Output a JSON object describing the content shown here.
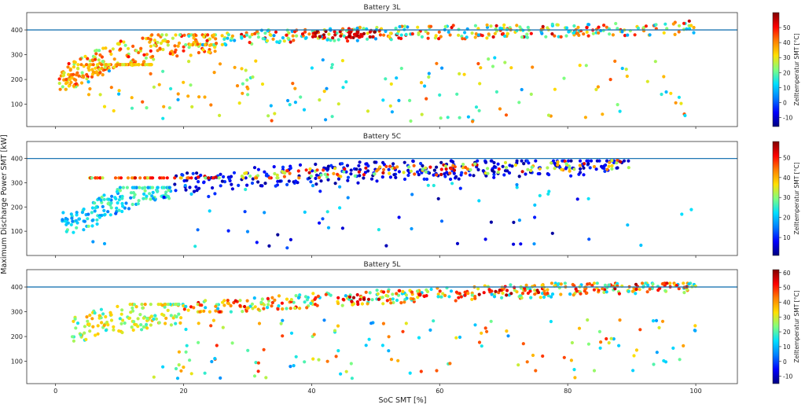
{
  "figure": {
    "ylabel": "Maximum Discharge Power SMT [kW]",
    "xlabel": "SoC SMT [%]",
    "colorbar_label": "Zelltemperatur SMT [°C]",
    "colormap": [
      "#00007f",
      "#0000ff",
      "#007fff",
      "#00e0ff",
      "#7fff7f",
      "#ffe000",
      "#ff7f00",
      "#ff0000",
      "#7f0000"
    ]
  },
  "chart_data": [
    {
      "type": "scatter",
      "title": "Battery 3L",
      "xlim": [
        -4.5,
        106.5
      ],
      "ylim": [
        10,
        470
      ],
      "yticks": [
        100,
        200,
        300,
        400
      ],
      "reference_line": 400,
      "color_range": [
        -16,
        60
      ],
      "colorbar_ticks": [
        -10,
        0,
        10,
        20,
        30,
        40,
        50
      ],
      "trend": [
        [
          0.5,
          190
        ],
        [
          2,
          210
        ],
        [
          5,
          250
        ],
        [
          8,
          280
        ],
        [
          10,
          300
        ],
        [
          15,
          330
        ],
        [
          20,
          350
        ],
        [
          30,
          370
        ],
        [
          40,
          380
        ],
        [
          50,
          385
        ],
        [
          60,
          390
        ],
        [
          70,
          395
        ],
        [
          80,
          400
        ],
        [
          90,
          405
        ],
        [
          100,
          410
        ]
      ],
      "clusters": [
        {
          "x0": 0.5,
          "x1": 25,
          "ylo": 160,
          "yhi": 380,
          "tlo": 20,
          "thi": 50,
          "n": 200
        },
        {
          "x0": 1,
          "x1": 15,
          "ylo": 70,
          "yhi": 260,
          "tlo": 25,
          "thi": 45,
          "n": 90
        },
        {
          "x0": 20,
          "x1": 100,
          "ylo": 340,
          "yhi": 450,
          "tlo": 5,
          "thi": 55,
          "n": 350
        },
        {
          "x0": 40,
          "x1": 50,
          "ylo": 340,
          "yhi": 405,
          "tlo": 50,
          "thi": 60,
          "n": 40
        },
        {
          "x0": 5,
          "x1": 100,
          "ylo": 30,
          "yhi": 300,
          "tlo": 5,
          "thi": 45,
          "n": 150
        }
      ]
    },
    {
      "type": "scatter",
      "title": "Battery 5C",
      "xlim": [
        -4.5,
        106.5
      ],
      "ylim": [
        0,
        470
      ],
      "yticks": [
        100,
        200,
        300,
        400
      ],
      "reference_line": 400,
      "color_range": [
        1,
        58
      ],
      "colorbar_ticks": [
        10,
        20,
        30,
        40,
        50
      ],
      "trend": [
        [
          0.5,
          160
        ],
        [
          2,
          120
        ],
        [
          5,
          160
        ],
        [
          10,
          230
        ],
        [
          15,
          270
        ],
        [
          20,
          300
        ],
        [
          30,
          320
        ],
        [
          40,
          335
        ],
        [
          50,
          345
        ],
        [
          60,
          355
        ],
        [
          70,
          360
        ],
        [
          80,
          370
        ],
        [
          90,
          375
        ]
      ],
      "clusters": [
        {
          "x0": 1,
          "x1": 18,
          "ylo": 70,
          "yhi": 280,
          "tlo": 15,
          "thi": 30,
          "n": 160
        },
        {
          "x0": 18,
          "x1": 90,
          "ylo": 220,
          "yhi": 390,
          "tlo": 2,
          "thi": 12,
          "n": 300
        },
        {
          "x0": 5,
          "x1": 90,
          "ylo": 320,
          "yhi": 410,
          "tlo": 28,
          "thi": 55,
          "n": 180
        },
        {
          "x0": 5,
          "x1": 100,
          "ylo": 30,
          "yhi": 300,
          "tlo": 2,
          "thi": 25,
          "n": 70
        }
      ]
    },
    {
      "type": "scatter",
      "title": "Battery 5L",
      "xlim": [
        -4.5,
        106.5
      ],
      "ylim": [
        10,
        470
      ],
      "yticks": [
        100,
        200,
        300,
        400
      ],
      "reference_line": 400,
      "color_range": [
        -15,
        62
      ],
      "colorbar_ticks": [
        -10,
        0,
        10,
        20,
        30,
        40,
        50,
        60
      ],
      "trend": [
        [
          2,
          220
        ],
        [
          5,
          240
        ],
        [
          10,
          270
        ],
        [
          20,
          310
        ],
        [
          30,
          330
        ],
        [
          40,
          345
        ],
        [
          50,
          360
        ],
        [
          60,
          370
        ],
        [
          70,
          380
        ],
        [
          80,
          390
        ],
        [
          90,
          400
        ],
        [
          100,
          405
        ]
      ],
      "clusters": [
        {
          "x0": 2,
          "x1": 20,
          "ylo": 100,
          "yhi": 330,
          "tlo": 15,
          "thi": 40,
          "n": 140
        },
        {
          "x0": 20,
          "x1": 100,
          "ylo": 300,
          "yhi": 415,
          "tlo": 10,
          "thi": 55,
          "n": 360
        },
        {
          "x0": 40,
          "x1": 100,
          "ylo": 350,
          "yhi": 415,
          "tlo": 45,
          "thi": 60,
          "n": 60
        },
        {
          "x0": 15,
          "x1": 100,
          "ylo": 30,
          "yhi": 270,
          "tlo": 5,
          "thi": 50,
          "n": 130
        }
      ]
    }
  ]
}
